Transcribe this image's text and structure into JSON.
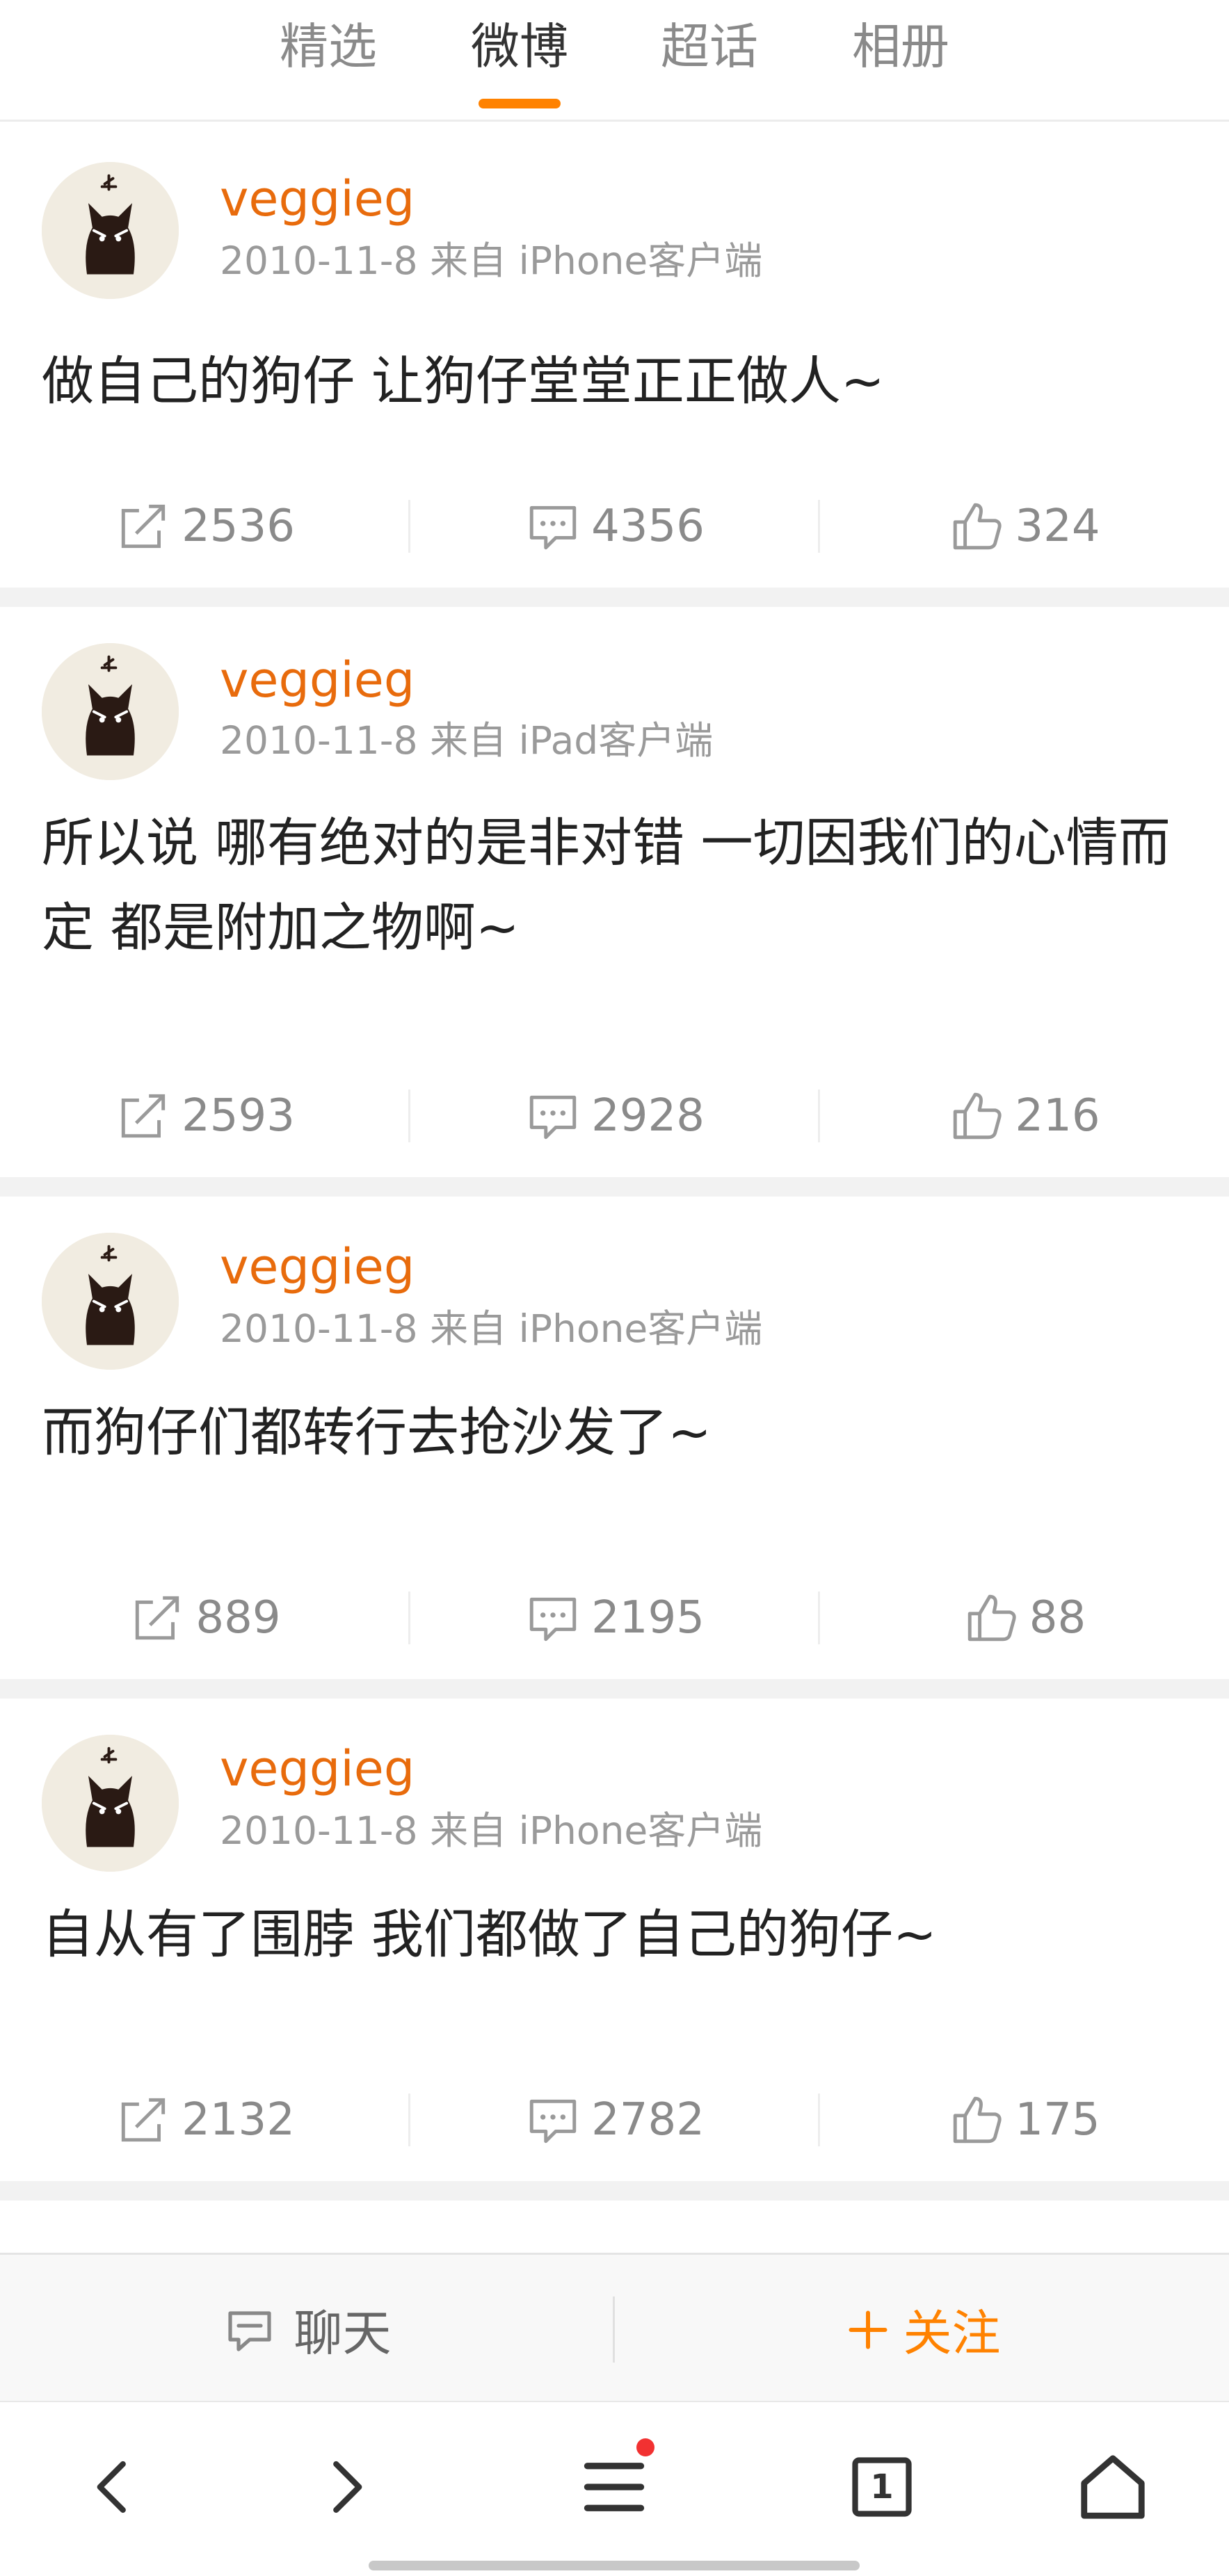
{
  "tabs": [
    {
      "label": "精选",
      "active": false
    },
    {
      "label": "微博",
      "active": true
    },
    {
      "label": "超话",
      "active": false
    },
    {
      "label": "相册",
      "active": false
    }
  ],
  "accent_color": "#ff8200",
  "username_color": "#e86b0c",
  "posts": [
    {
      "username": "veggieg",
      "meta": "2010-11-8 来自 iPhone客户端",
      "text": "做自己的狗仔 让狗仔堂堂正正做人~",
      "reposts": "2536",
      "comments": "4356",
      "likes": "324"
    },
    {
      "username": "veggieg",
      "meta": "2010-11-8 来自 iPad客户端",
      "text": "所以说 哪有绝对的是非对错 一切因我们的心情而定 都是附加之物啊~",
      "reposts": "2593",
      "comments": "2928",
      "likes": "216"
    },
    {
      "username": "veggieg",
      "meta": "2010-11-8 来自 iPhone客户端",
      "text": "而狗仔们都转行去抢沙发了~",
      "reposts": "889",
      "comments": "2195",
      "likes": "88"
    },
    {
      "username": "veggieg",
      "meta": "2010-11-8 来自 iPhone客户端",
      "text": "自从有了围脖 我们都做了自己的狗仔~",
      "reposts": "2132",
      "comments": "2782",
      "likes": "175"
    }
  ],
  "action_bar": {
    "chat_label": "聊天",
    "follow_label": "关注"
  },
  "browser_nav": {
    "tab_count": "1",
    "menu_has_notification": true
  },
  "icons": {
    "repost": "repost-icon",
    "comment": "comment-icon",
    "like": "thumbs-up-icon",
    "chat": "chat-icon",
    "follow": "plus-icon",
    "back": "chevron-left-icon",
    "forward": "chevron-right-icon",
    "menu": "menu-icon",
    "tabs": "tabs-icon",
    "home": "home-icon"
  }
}
